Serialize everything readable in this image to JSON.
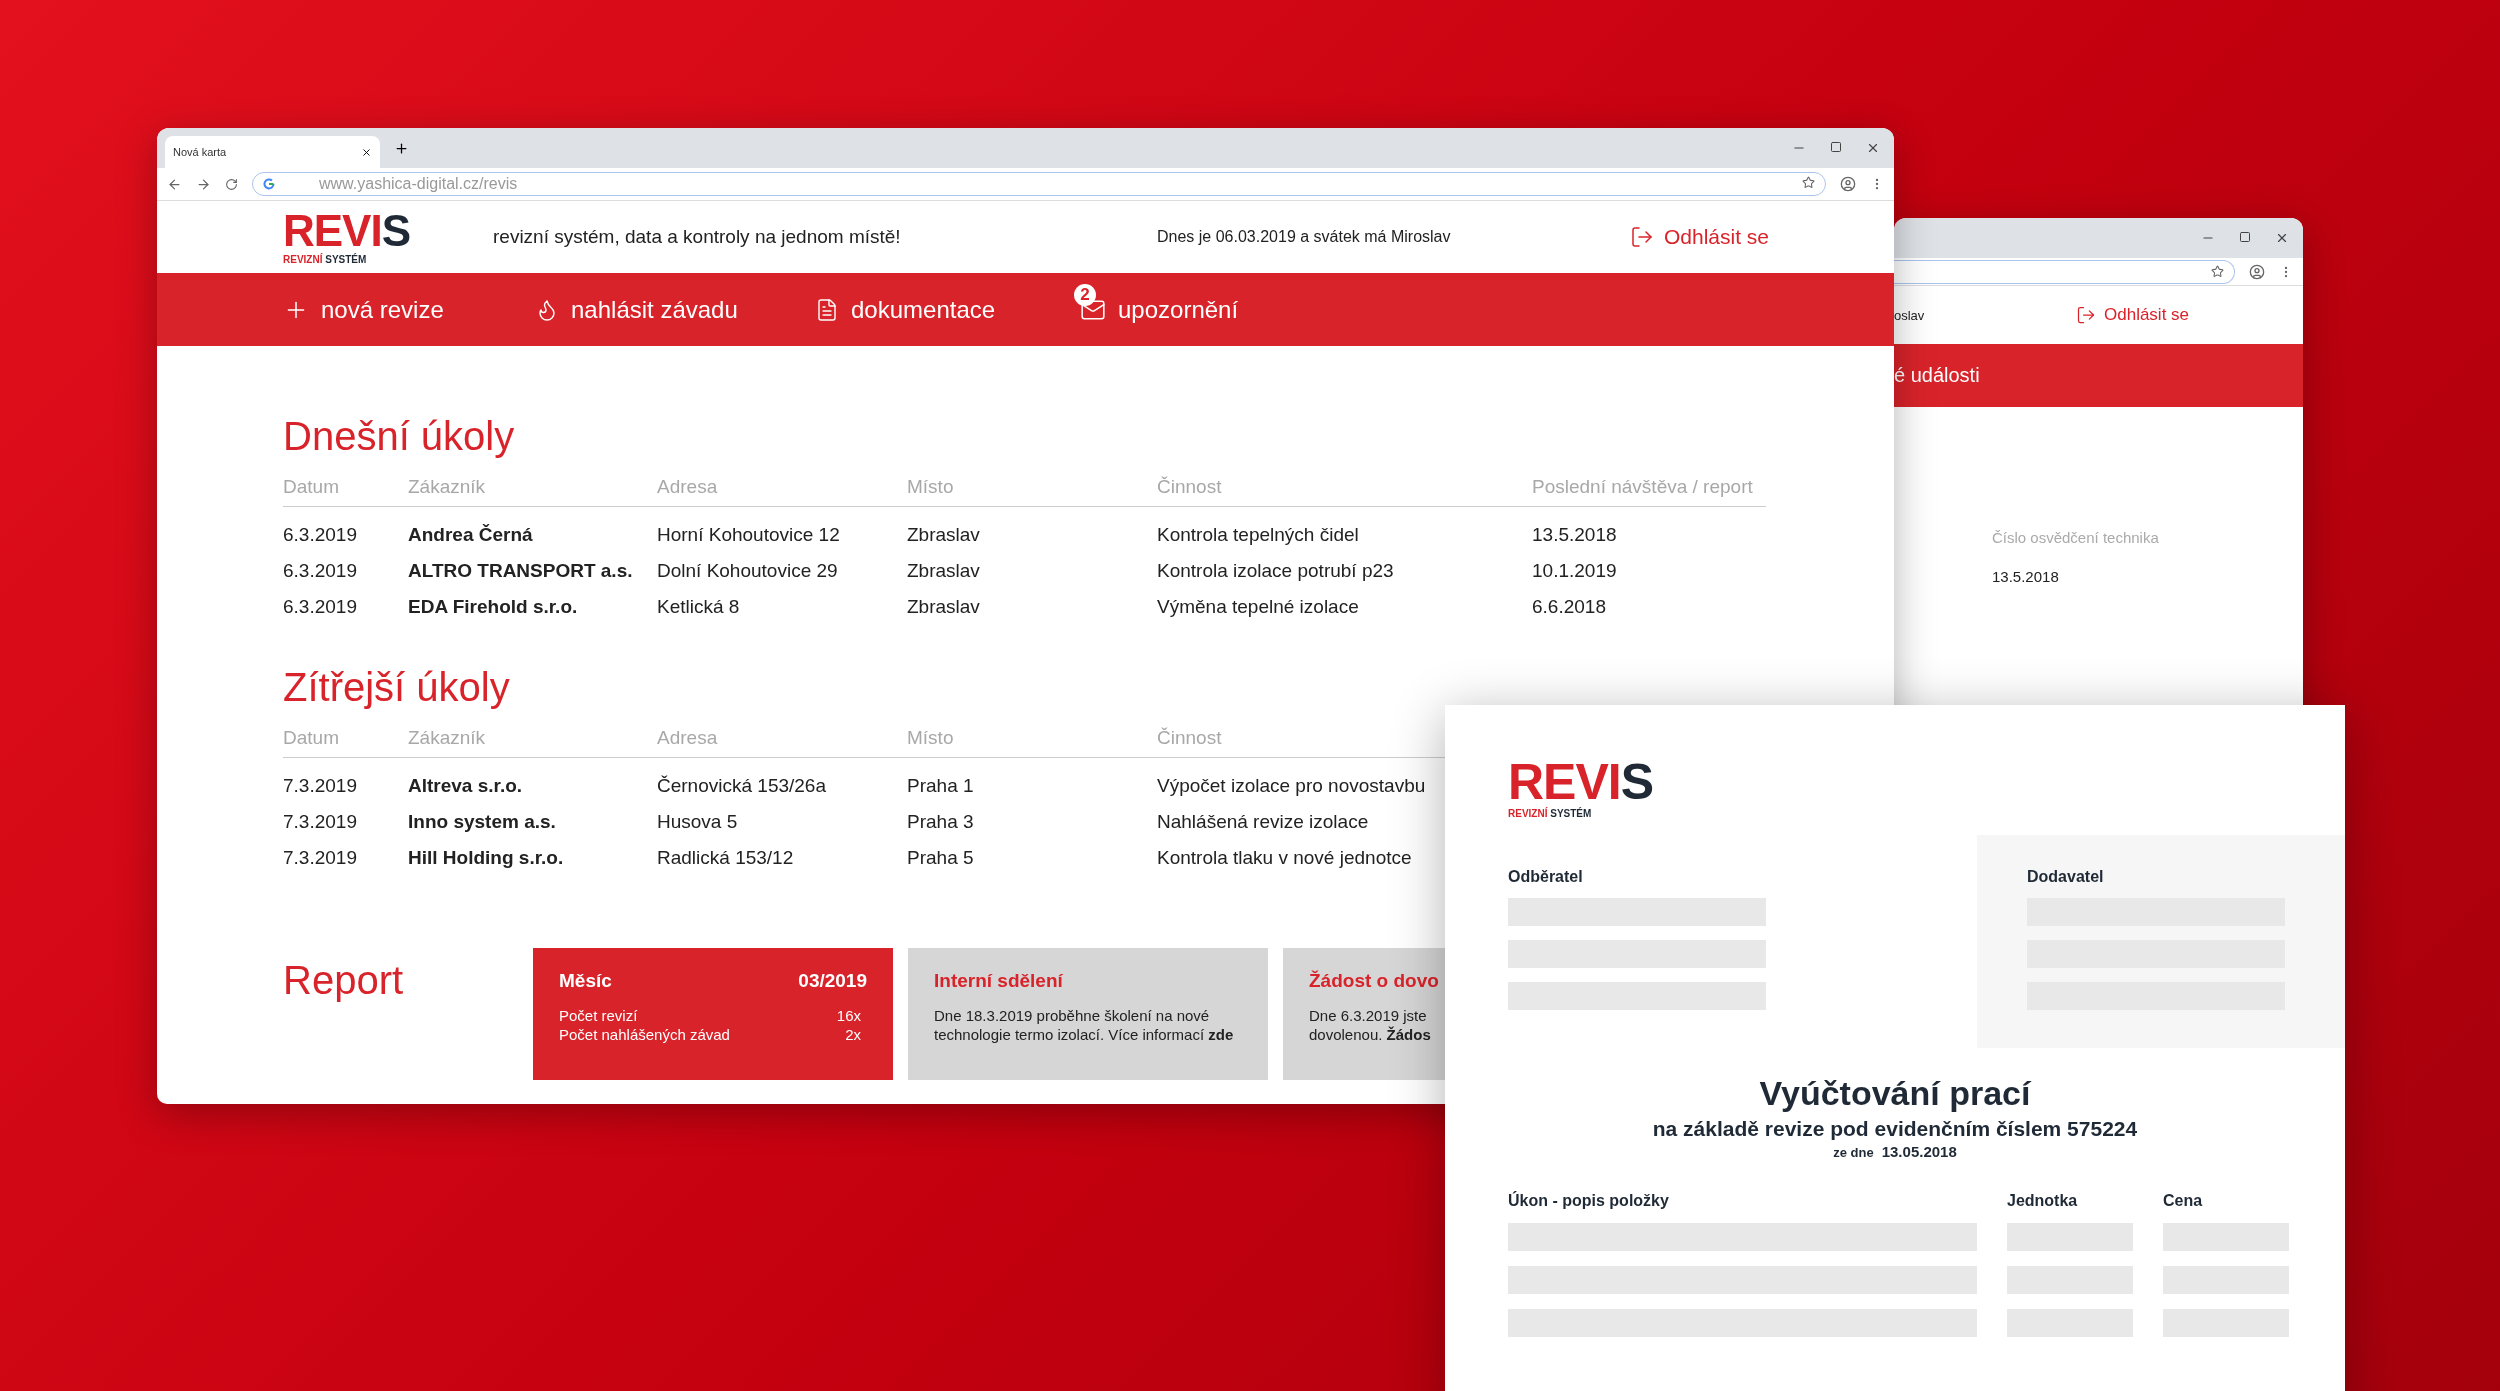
{
  "main_window": {
    "tab": {
      "title": "Nová karta"
    },
    "address": "www.yashica-digital.cz/revis",
    "logo": {
      "name_red": "REVI",
      "name_dark": "S",
      "tagline_red": "REVIZNÍ",
      "tagline_dark": "SYSTÉM"
    },
    "header": {
      "tagline": "revizní systém, data a kontroly na jednom místě!",
      "date_note": "Dnes je 06.03.2019 a svátek má Miroslav",
      "logout": "Odhlásit se"
    },
    "nav": [
      {
        "kind": "add",
        "label": "nová revize"
      },
      {
        "kind": "fault",
        "label": "nahlásit závadu"
      },
      {
        "kind": "docs",
        "label": "dokumentace"
      },
      {
        "kind": "mail",
        "label": "upozornění",
        "badge": "2"
      }
    ],
    "sections": [
      {
        "title": "Dnešní úkoly",
        "columns": [
          "Datum",
          "Zákazník",
          "Adresa",
          "Místo",
          "Činnost",
          "Poslední návštěva / report"
        ],
        "rows": [
          [
            "6.3.2019",
            "Andrea Černá",
            "Horní Kohoutovice 12",
            "Zbraslav",
            "Kontrola tepelných čidel",
            "13.5.2018"
          ],
          [
            "6.3.2019",
            "ALTRO TRANSPORT a.s.",
            "Dolní Kohoutovice 29",
            "Zbraslav",
            "Kontrola izolace potrubí p23",
            "10.1.2019"
          ],
          [
            "6.3.2019",
            "EDA Firehold s.r.o.",
            "Ketlická 8",
            "Zbraslav",
            "Výměna tepelné izolace",
            "6.6.2018"
          ]
        ]
      },
      {
        "title": "Zítřejší úkoly",
        "columns": [
          "Datum",
          "Zákazník",
          "Adresa",
          "Místo",
          "Činnost"
        ],
        "rows": [
          [
            "7.3.2019",
            "Altreva s.r.o.",
            "Černovická 153/26a",
            "Praha 1",
            "Výpočet izolace pro novostavbu"
          ],
          [
            "7.3.2019",
            "Inno system a.s.",
            "Husova 5",
            "Praha 3",
            "Nahlášená revize izolace"
          ],
          [
            "7.3.2019",
            "Hill Holding s.r.o.",
            "Radlická 153/12",
            "Praha 5",
            "Kontrola tlaku v nové jednotce"
          ]
        ]
      }
    ],
    "report": {
      "title": "Report",
      "month_card": {
        "label": "Měsíc",
        "value": "03/2019",
        "rows": [
          {
            "label": "Počet revizí",
            "value": "16x"
          },
          {
            "label": "Počet nahlášených závad",
            "value": "2x"
          }
        ]
      },
      "cards": [
        {
          "title": "Interní sdělení",
          "lines": [
            "Dne 18.3.2019 proběhne školení na nové",
            "technologie termo izolací. Více informací **zde**"
          ]
        },
        {
          "title": "Žádost o dovo",
          "lines": [
            "Dne 6.3.2019 jste",
            "dovolenou. **Žádos**"
          ]
        }
      ]
    }
  },
  "back_window": {
    "header_text": "oslav",
    "logout": "Odhlásit se",
    "nav_text": "é události",
    "field_label": "Číslo osvědčení technika",
    "field_value": "13.5.2018"
  },
  "document": {
    "logo": {
      "name_red": "REVI",
      "name_dark": "S",
      "tagline_red": "REVIZNÍ",
      "tagline_dark": "SYSTÉM"
    },
    "customer": {
      "label": "Odběratel"
    },
    "supplier": {
      "label": "Dodavatel"
    },
    "title": "Vyúčtování prací",
    "subtitle": "na základě revize pod evidenčním číslem 575224",
    "date_label": "ze dne",
    "date": "13.05.2018",
    "columns": [
      "Úkon - popis položky",
      "Jednotka",
      "Cena"
    ]
  }
}
